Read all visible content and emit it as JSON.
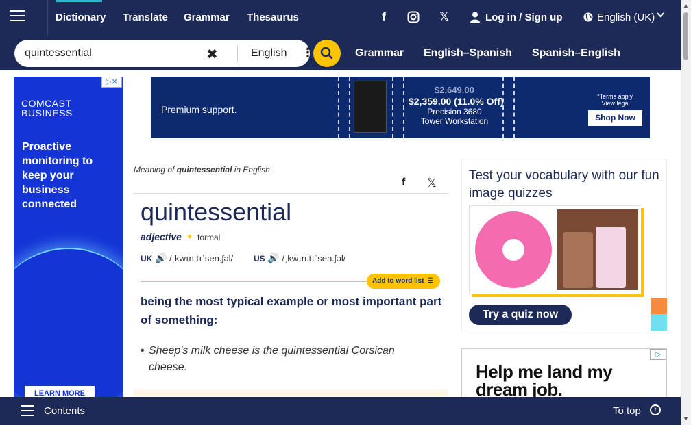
{
  "nav": {
    "links": [
      "Dictionary",
      "Translate",
      "Grammar",
      "Thesaurus"
    ],
    "login": "Log in / Sign up",
    "language": "English (UK)"
  },
  "search": {
    "value": "quintessential",
    "language": "English"
  },
  "sublinks": [
    "Grammar",
    "English–Spanish",
    "Spanish–English"
  ],
  "left_ad": {
    "brand_line1": "COMCAST",
    "brand_line2": "BUSINESS",
    "headline": "Proactive monitoring to keep your business connected",
    "cta": "LEARN MORE"
  },
  "banner_ad": {
    "text": "Premium support.",
    "old_price": "$2,649.00",
    "new_price": "$2,359.00 (11.0% Off)",
    "product": "Precision 3680 Tower Workstation",
    "terms_line1": "*Terms apply.",
    "terms_line2": "View legal",
    "shop": "Shop Now"
  },
  "entry": {
    "meaning_prefix": "Meaning of ",
    "meaning_word": "quintessential",
    "meaning_suffix": " in English",
    "headword": "quintessential",
    "pos": "adjective",
    "register": "formal",
    "uk_label": "UK",
    "uk_ipa": "/ˌkwɪn.tɪˈsen.ʃəl/",
    "us_label": "US",
    "us_ipa": "/ˌkwɪn.tɪˈsen.ʃəl/",
    "add_to_list": "Add to word list",
    "definition": "being the most typical example or most important part of something:",
    "example": "Sheep's milk cheese is the quintessential Corsican cheese."
  },
  "quiz": {
    "title": "Test your vocabulary with our fun image quizzes",
    "button": "Try a quiz now"
  },
  "right_ad": {
    "headline": "Help me land my dream job."
  },
  "bottom": {
    "contents": "Contents",
    "to_top": "To top"
  },
  "colors": {
    "navy": "#1d2a57",
    "accent_yellow": "#fec400",
    "ad_blue": "#1434d6"
  }
}
